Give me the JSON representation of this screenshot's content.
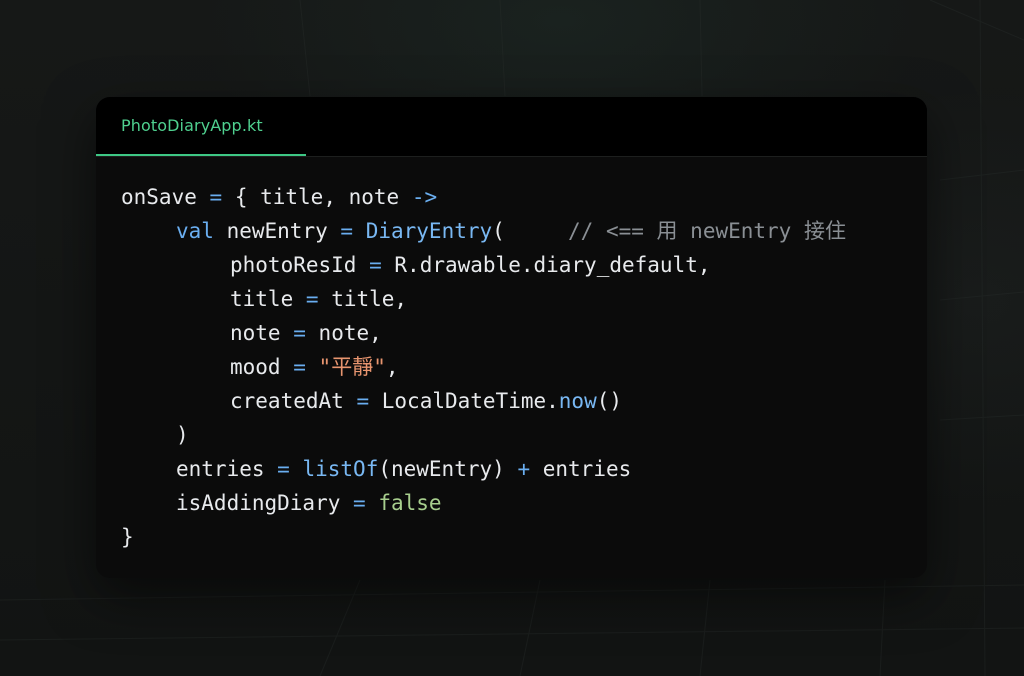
{
  "colors": {
    "background": "#151716",
    "window_bg": "#0b0b0b",
    "tab_accent": "#4fd08f",
    "keyword": "#6aaef0",
    "function": "#79b8f3",
    "string": "#e8956f",
    "boolean": "#a8cf8e",
    "comment": "#8a8f94",
    "text": "#e8eaed"
  },
  "editor": {
    "tab_label": "PhotoDiaryApp.kt",
    "code": {
      "l1": {
        "ident": "onSave",
        "eq": "=",
        "open": "{ title, note",
        "arrow": "->"
      },
      "l2": {
        "kw": "val",
        "ident": "newEntry",
        "eq": "=",
        "fn": "DiaryEntry",
        "paren": "(",
        "comment": "// <== 用 newEntry 接住"
      },
      "l3": {
        "ident": "photoResId",
        "eq": "=",
        "value": "R.drawable.diary_default,"
      },
      "l4": {
        "ident": "title",
        "eq": "=",
        "value": "title,"
      },
      "l5": {
        "ident": "note",
        "eq": "=",
        "value": "note,"
      },
      "l6": {
        "ident": "mood",
        "eq": "=",
        "string": "\"平靜\"",
        "comma": ","
      },
      "l7": {
        "ident": "createdAt",
        "eq": "=",
        "obj": "LocalDateTime.",
        "fn": "now",
        "call": "()"
      },
      "l8": {
        "close": ")"
      },
      "l9": {
        "ident": "entries",
        "eq": "=",
        "fn": "listOf",
        "args": "(newEntry)",
        "plus": "+",
        "rest": "entries"
      },
      "l10": {
        "ident": "isAddingDiary",
        "eq": "=",
        "bool": "false"
      },
      "l11": {
        "close": "}"
      }
    }
  }
}
